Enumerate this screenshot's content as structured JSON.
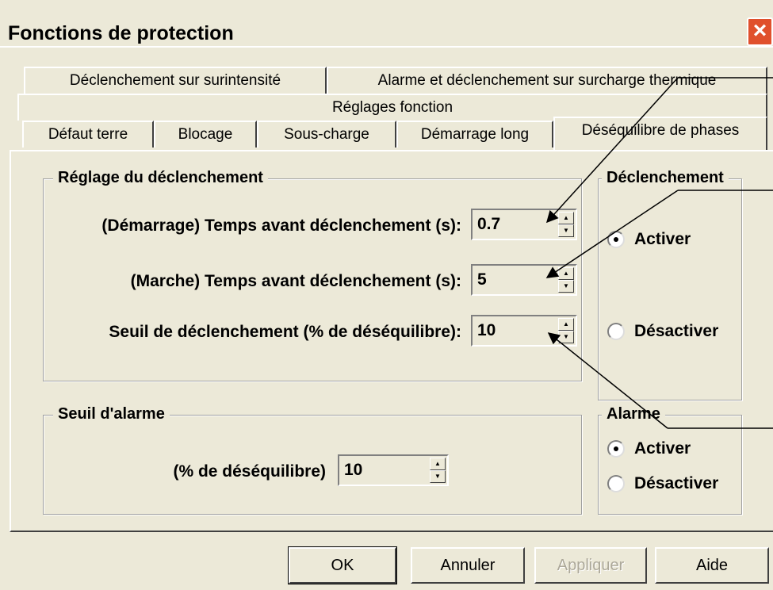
{
  "window": {
    "title": "Fonctions de protection"
  },
  "tabs": {
    "row1": [
      "Déclenchement sur surintensité",
      "Alarme et déclenchement sur surcharge thermique"
    ],
    "row2": [
      "Réglages fonction"
    ],
    "row3": [
      "Défaut terre",
      "Blocage",
      "Sous-charge",
      "Démarrage long",
      "Déséquilibre de phases"
    ],
    "active": "Déséquilibre de phases"
  },
  "trip_group": {
    "title": "Réglage du déclenchement",
    "start_delay_label": "(Démarrage) Temps avant déclenchement (s):",
    "start_delay_value": "0.7",
    "run_delay_label": "(Marche) Temps avant déclenchement (s):",
    "run_delay_value": "5",
    "threshold_label": "Seuil de déclenchement (% de déséquilibre):",
    "threshold_value": "10"
  },
  "trip_enable_group": {
    "title": "Déclenchement",
    "enable_label": "Activer",
    "disable_label": "Désactiver",
    "selected": "Activer"
  },
  "alarm_group": {
    "title": "Seuil d'alarme",
    "threshold_label": "(% de déséquilibre)",
    "threshold_value": "10"
  },
  "alarm_enable_group": {
    "title": "Alarme",
    "enable_label": "Activer",
    "disable_label": "Désactiver",
    "selected": "Activer"
  },
  "buttons": {
    "ok": "OK",
    "cancel": "Annuler",
    "apply": "Appliquer",
    "help": "Aide"
  }
}
